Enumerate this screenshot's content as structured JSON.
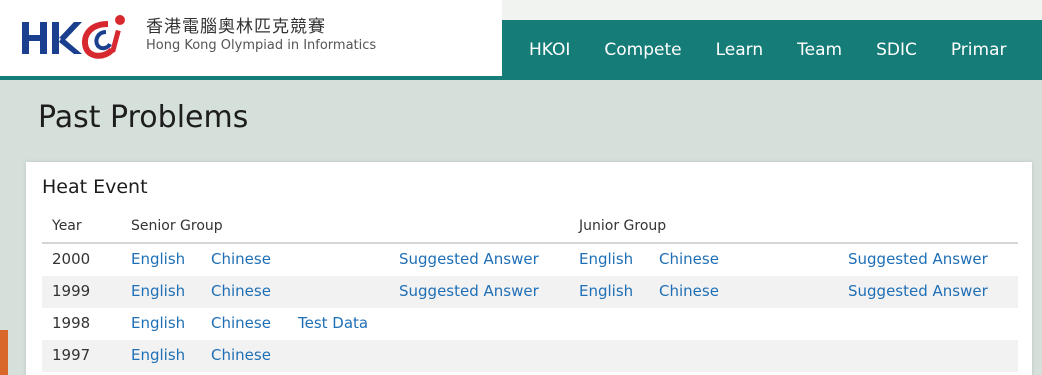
{
  "header": {
    "logo_text": "HKOI",
    "org_name_cn": "香港電腦奧林匹克競賽",
    "org_name_en": "Hong Kong Olympiad in Informatics",
    "nav": [
      "HKOI",
      "Compete",
      "Learn",
      "Team",
      "SDIC",
      "Primar"
    ]
  },
  "page_title": "Past Problems",
  "section": {
    "title": "Heat Event",
    "columns": {
      "year": "Year",
      "senior": "Senior Group",
      "junior": "Junior Group"
    },
    "rows": [
      {
        "year": "2000",
        "s_en": "English",
        "s_zh": "Chinese",
        "s_td": "",
        "s_ans": "Suggested Answer",
        "j_en": "English",
        "j_zh": "Chinese",
        "j_ans": "Suggested Answer"
      },
      {
        "year": "1999",
        "s_en": "English",
        "s_zh": "Chinese",
        "s_td": "",
        "s_ans": "Suggested Answer",
        "j_en": "English",
        "j_zh": "Chinese",
        "j_ans": "Suggested Answer"
      },
      {
        "year": "1998",
        "s_en": "English",
        "s_zh": "Chinese",
        "s_td": "Test Data",
        "s_ans": "",
        "j_en": "",
        "j_zh": "",
        "j_ans": ""
      },
      {
        "year": "1997",
        "s_en": "English",
        "s_zh": "Chinese",
        "s_td": "",
        "s_ans": "",
        "j_en": "",
        "j_zh": "",
        "j_ans": ""
      }
    ]
  },
  "colors": {
    "nav_bg": "#167c78",
    "link": "#1f6fb6",
    "page_bg": "#d6e0da",
    "logo_red": "#d7282f",
    "logo_blue": "#1b3f8f"
  }
}
